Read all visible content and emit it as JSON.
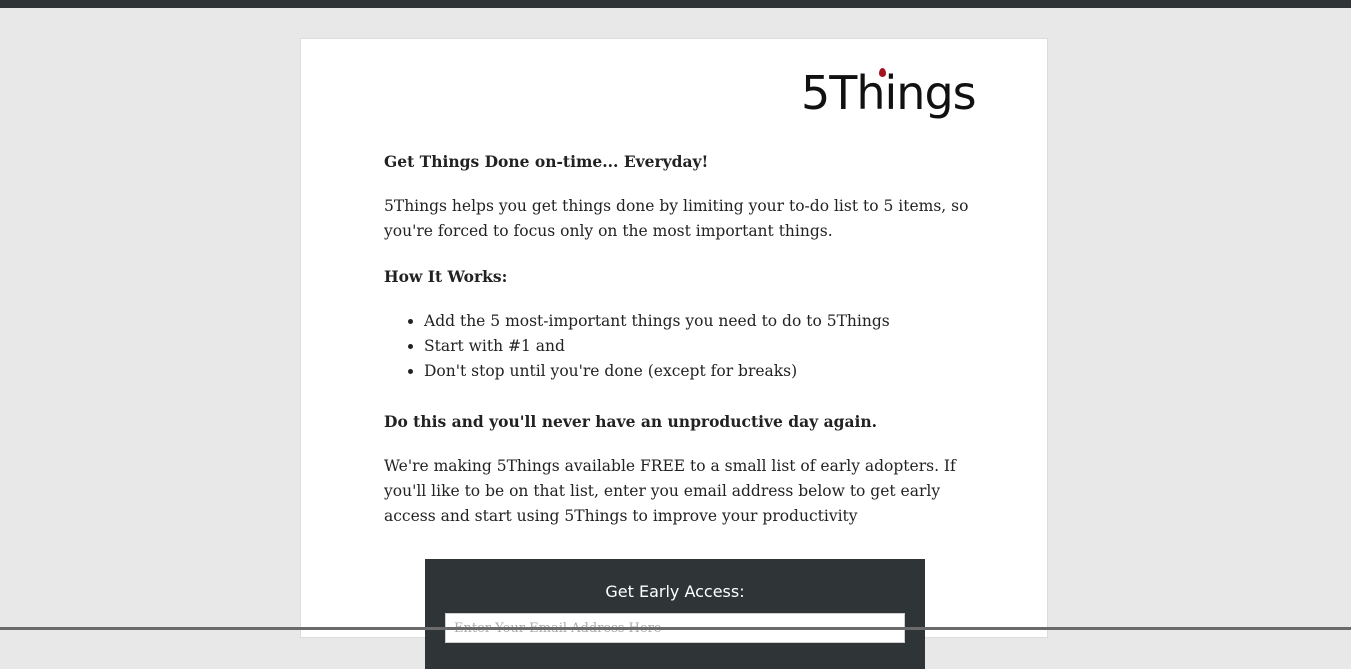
{
  "brand": {
    "logo_text": "5Things"
  },
  "content": {
    "headline": "Get Things Done on-time... Everyday!",
    "intro": "5Things helps you get things done by limiting your to-do list to 5 items, so you're forced to focus only on the most important things.",
    "how_title": "How It Works:",
    "steps": [
      "Add the 5 most-important things you need to do to 5Things",
      "Start with #1 and",
      "Don't stop until you're done (except for breaks)"
    ],
    "promise": "Do this and you'll never have an unproductive day again.",
    "offer": "We're making 5Things available FREE to a small list of early adopters. If you'll like to be on that list, enter you email address below to get early access and start using 5Things to improve your productivity"
  },
  "signup": {
    "title": "Get Early Access:",
    "email_placeholder": "Enter Your Email Address Here"
  },
  "colors": {
    "background": "#e8e8e8",
    "top_bar": "#2f3537",
    "signup_panel": "#2f3537",
    "logo_accent": "#a5141c"
  }
}
